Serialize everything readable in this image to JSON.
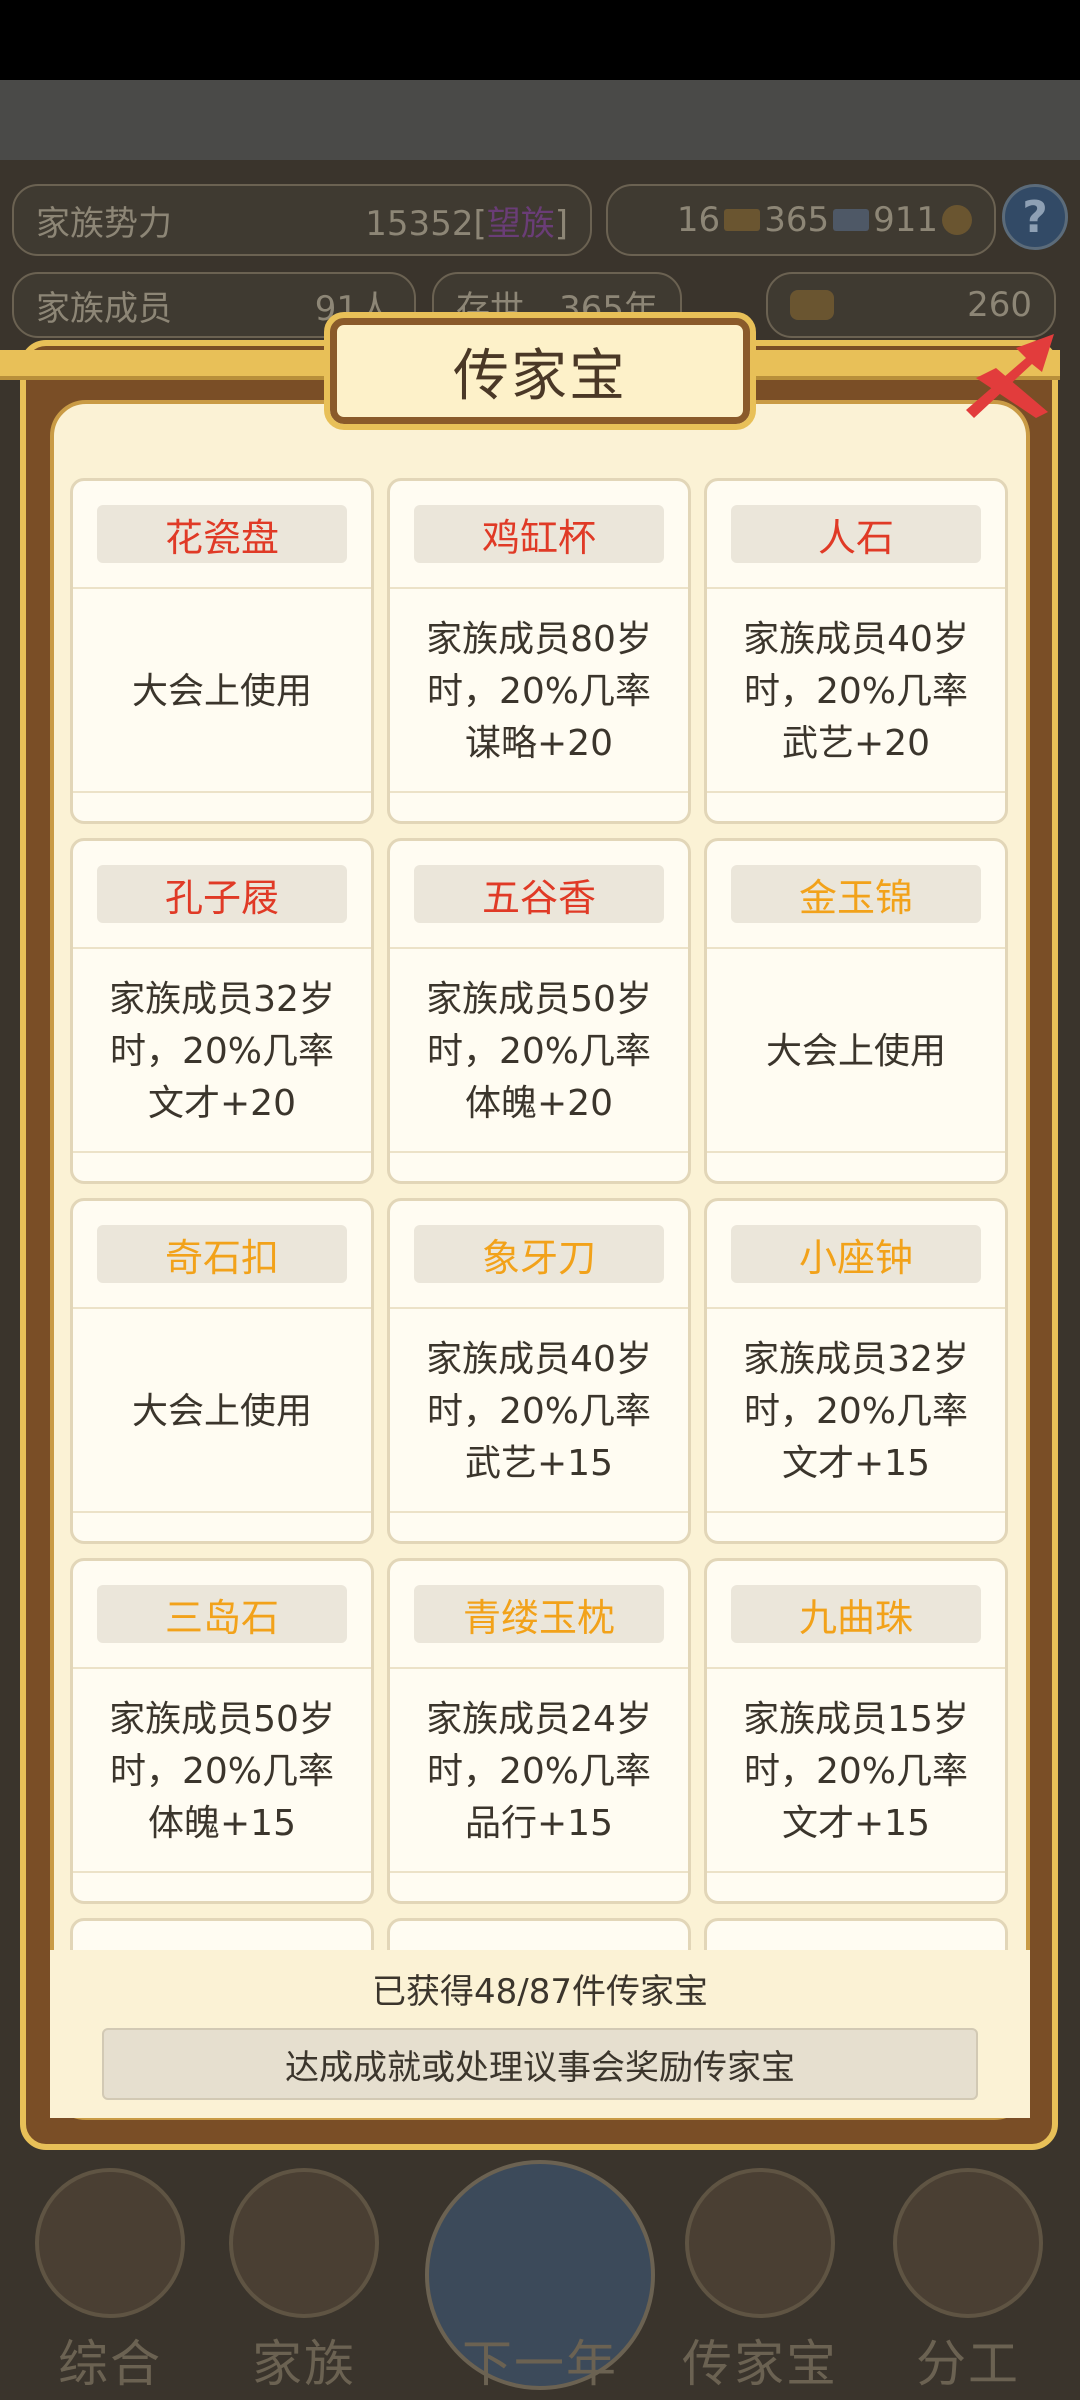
{
  "hud": {
    "power_label": "家族势力",
    "power_value": "15352",
    "power_bracket_open": "[",
    "power_rank": "望族",
    "power_bracket_close": "]",
    "gold_count": "16",
    "silver_count": "365",
    "coin_count": "911",
    "members_label": "家族成员",
    "members_value": "91人",
    "age_label": "存世",
    "age_value": "365年",
    "ingot_count": "260",
    "help_label": "?"
  },
  "dialog": {
    "title": "传家宝",
    "close_icon": "close-icon"
  },
  "treasures": [
    {
      "name": "花瓷盘",
      "color": "#e03a26",
      "desc": "大会上使用"
    },
    {
      "name": "鸡缸杯",
      "color": "#e03a26",
      "desc": "家族成员80岁\n时，20%几率\n谋略+20"
    },
    {
      "name": "人石",
      "color": "#e03a26",
      "desc": "家族成员40岁\n时，20%几率\n武艺+20"
    },
    {
      "name": "孔子屐",
      "color": "#e03a26",
      "desc": "家族成员32岁\n时，20%几率\n文才+20"
    },
    {
      "name": "五谷香",
      "color": "#e03a26",
      "desc": "家族成员50岁\n时，20%几率\n体魄+20"
    },
    {
      "name": "金玉锦",
      "color": "#f2a21a",
      "desc": "大会上使用"
    },
    {
      "name": "奇石扣",
      "color": "#f2a21a",
      "desc": "大会上使用"
    },
    {
      "name": "象牙刀",
      "color": "#f2a21a",
      "desc": "家族成员40岁\n时，20%几率\n武艺+15"
    },
    {
      "name": "小座钟",
      "color": "#f2a21a",
      "desc": "家族成员32岁\n时，20%几率\n文才+15"
    },
    {
      "name": "三岛石",
      "color": "#f2a21a",
      "desc": "家族成员50岁\n时，20%几率\n体魄+15"
    },
    {
      "name": "青缕玉枕",
      "color": "#f2a21a",
      "desc": "家族成员24岁\n时，20%几率\n品行+15"
    },
    {
      "name": "九曲珠",
      "color": "#f2a21a",
      "desc": "家族成员15岁\n时，20%几率\n文才+15"
    }
  ],
  "footer": {
    "count_text": "已获得48/87件传家宝",
    "hint_button": "达成成就或处理议事会奖励传家宝"
  },
  "nav": {
    "items": [
      {
        "label": "综合",
        "icon": "scroll-icon"
      },
      {
        "label": "家族",
        "icon": "house-icon"
      },
      {
        "label": "下一年",
        "icon": "mountain-icon"
      },
      {
        "label": "传家宝",
        "icon": "treasure-icon"
      },
      {
        "label": "分工",
        "icon": "person-icon"
      }
    ]
  }
}
